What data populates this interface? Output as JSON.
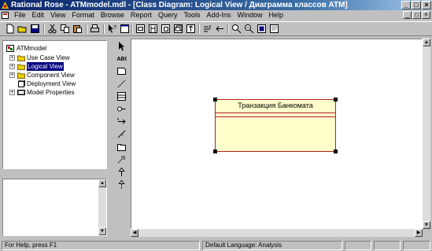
{
  "window": {
    "title": "Rational Rose - ATMmodel.mdl - [Class Diagram: Logical View / Диаграмма классов ATM]",
    "buttons": {
      "minimize": "_",
      "maximize": "□",
      "close": "×"
    }
  },
  "menu": {
    "items": [
      "File",
      "Edit",
      "View",
      "Format",
      "Browse",
      "Report",
      "Query",
      "Tools",
      "Add-Ins",
      "Window",
      "Help"
    ]
  },
  "toolbar": {
    "icons": [
      "new-icon",
      "open-icon",
      "save-icon",
      "cut-icon",
      "copy-icon",
      "paste-icon",
      "print-icon",
      "context-help-icon",
      "view-documentation-icon",
      "browse-class-diagram-icon",
      "browse-interaction-diagram-icon",
      "browse-component-diagram-icon",
      "browse-deployment-diagram-icon",
      "browse-parent-icon",
      "browse-previous-icon",
      "zoom-in-icon",
      "zoom-out-icon",
      "fit-in-window-icon",
      "undo-fit-icon"
    ]
  },
  "browser": {
    "root": "ATMmodel",
    "items": [
      {
        "label": "Use Case View",
        "expander": "+"
      },
      {
        "label": "Logical View",
        "expander": "+",
        "selected": true
      },
      {
        "label": "Component View",
        "expander": "+"
      },
      {
        "label": "Deployment View",
        "expander": ""
      },
      {
        "label": "Model Properties",
        "expander": "+"
      }
    ]
  },
  "toolbox": {
    "tools": [
      "selection-arrow",
      "text-box",
      "note",
      "anchor-note",
      "class",
      "interface",
      "unidirectional-association",
      "association-class",
      "package",
      "dependency",
      "generalization",
      "realization"
    ]
  },
  "diagram": {
    "class_name": "Транзакция Банкомата",
    "colors": {
      "fill": "#ffffcc",
      "border": "#b22222"
    }
  },
  "status": {
    "help": "For Help, press F1",
    "language": "Default Language: Analysis"
  }
}
